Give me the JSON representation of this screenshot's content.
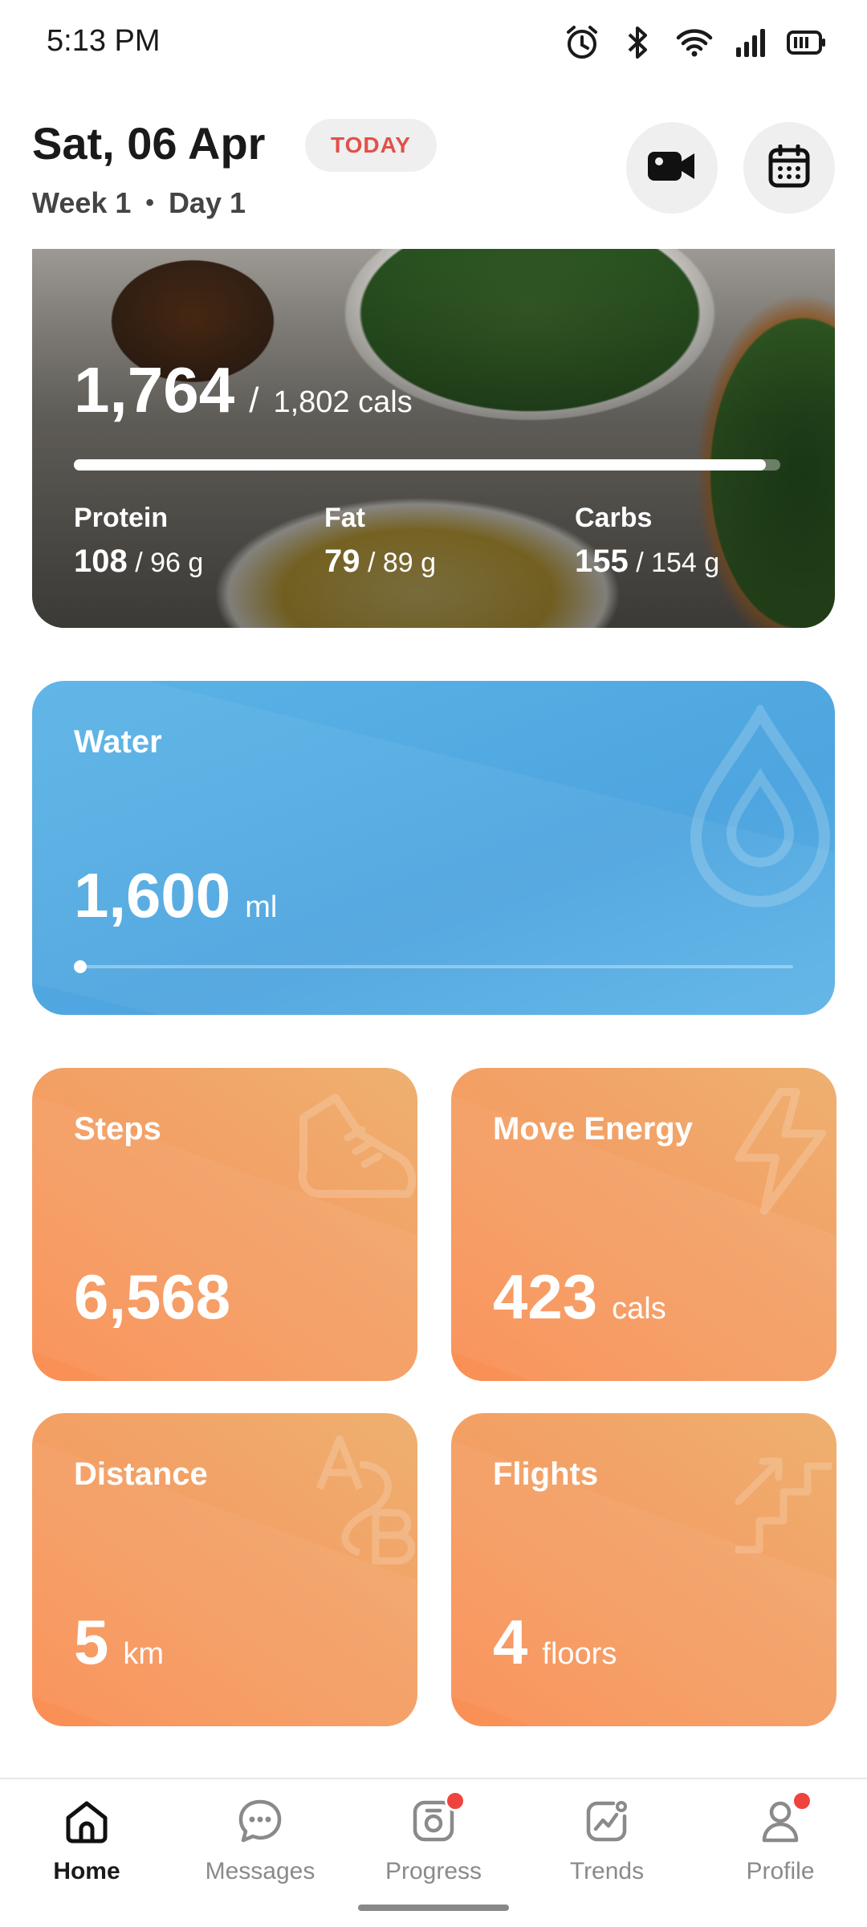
{
  "status_bar": {
    "time": "5:13 PM",
    "icons": [
      "alarm-icon",
      "bluetooth-icon",
      "wifi-icon",
      "signal-icon",
      "battery-icon"
    ]
  },
  "header": {
    "date": "Sat, 06 Apr",
    "today_badge": "TODAY",
    "week": "Week 1",
    "separator": "•",
    "day": "Day 1",
    "buttons": [
      "video-camera-icon",
      "calendar-icon"
    ]
  },
  "nutrition": {
    "calories_value": "1,764",
    "calories_separator": "/",
    "calories_total": "1,802 cals",
    "progress_fraction": 0.98,
    "macros": [
      {
        "label": "Protein",
        "value": "108",
        "target": "/ 96 g"
      },
      {
        "label": "Fat",
        "value": "79",
        "target": "/ 89 g"
      },
      {
        "label": "Carbs",
        "value": "155",
        "target": "/ 154 g"
      }
    ]
  },
  "water": {
    "title": "Water",
    "value": "1,600",
    "unit": "ml",
    "progress_fraction": 0.0,
    "icon": "water-drop-icon"
  },
  "cards": {
    "steps": {
      "title": "Steps",
      "value": "6,568",
      "unit": "",
      "icon": "shoe-icon"
    },
    "move_energy": {
      "title": "Move Energy",
      "value": "423",
      "unit": "cals",
      "icon": "lightning-icon"
    },
    "distance": {
      "title": "Distance",
      "value": "5",
      "unit": "km",
      "icon": "a-to-b-icon"
    },
    "flights": {
      "title": "Flights",
      "value": "4",
      "unit": "floors",
      "icon": "stairs-icon"
    }
  },
  "bottom_nav": {
    "items": [
      {
        "label": "Home",
        "icon": "home-icon",
        "active": true,
        "badge": false
      },
      {
        "label": "Messages",
        "icon": "chat-icon",
        "active": false,
        "badge": false
      },
      {
        "label": "Progress",
        "icon": "camera-progress-icon",
        "active": false,
        "badge": true
      },
      {
        "label": "Trends",
        "icon": "trends-icon",
        "active": false,
        "badge": false
      },
      {
        "label": "Profile",
        "icon": "profile-icon",
        "active": false,
        "badge": true
      }
    ]
  },
  "colors": {
    "today_badge_text": "#e2504a",
    "water_card": "#4ea5df",
    "activity_card": "#f3a065",
    "badge_dot": "#f0433e"
  }
}
